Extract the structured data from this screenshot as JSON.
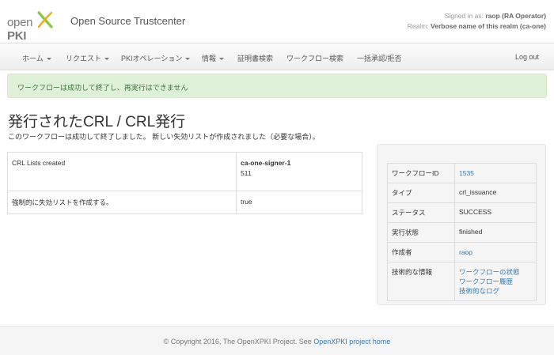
{
  "header": {
    "logo_left": "open",
    "logo_right": "PKI",
    "app_title": "Open Source Trustcenter",
    "signed_in_label": "Signed in as:",
    "user": "raop (RA Operator)",
    "realm_label": "Realm:",
    "realm": "Verbose name of this realm (ca-one)"
  },
  "nav": {
    "items": [
      {
        "label": "ホーム"
      },
      {
        "label": "リクエスト"
      },
      {
        "label": "PKIオペレーション"
      },
      {
        "label": "情報"
      },
      {
        "label": "証明書検索"
      },
      {
        "label": "ワークフロー検索"
      },
      {
        "label": "一括承認/拒否"
      }
    ],
    "logout": "Log out"
  },
  "alert": {
    "text": "ワークフローは成功して終了し、再実行はできません"
  },
  "page": {
    "title": "発行されたCRL / CRL発行",
    "description": "このワークフローは成功して終了しました。 新しい失効リストが作成されました（必要な場合）。"
  },
  "result": {
    "rows": [
      {
        "key": "CRL Lists created",
        "value1": "ca-one-signer-1",
        "value2": "511"
      },
      {
        "key": "強制的に失効リストを作成する。",
        "value1": "true"
      }
    ]
  },
  "info": {
    "rows": [
      {
        "key": "ワークフローID",
        "value": "1535"
      },
      {
        "key": "タイプ",
        "value": "crl_issuance"
      },
      {
        "key": "ステータス",
        "value": "SUCCESS"
      },
      {
        "key": "実行状態",
        "value": "finished"
      },
      {
        "key": "作成者",
        "value": "raop"
      },
      {
        "key": "技術的な情報",
        "links": [
          "ワークフローの状態",
          "ワークフロー履歴",
          "技術的なログ"
        ]
      }
    ]
  },
  "footer": {
    "text": "© Copyright 2016, The OpenXPKI Project. See ",
    "link": "OpenXPKI project home"
  },
  "colors": {
    "link": "#337ab7",
    "alert_bg": "#dff0d8",
    "alert_text": "#3c763d",
    "logo_green": "#8cc63f"
  }
}
